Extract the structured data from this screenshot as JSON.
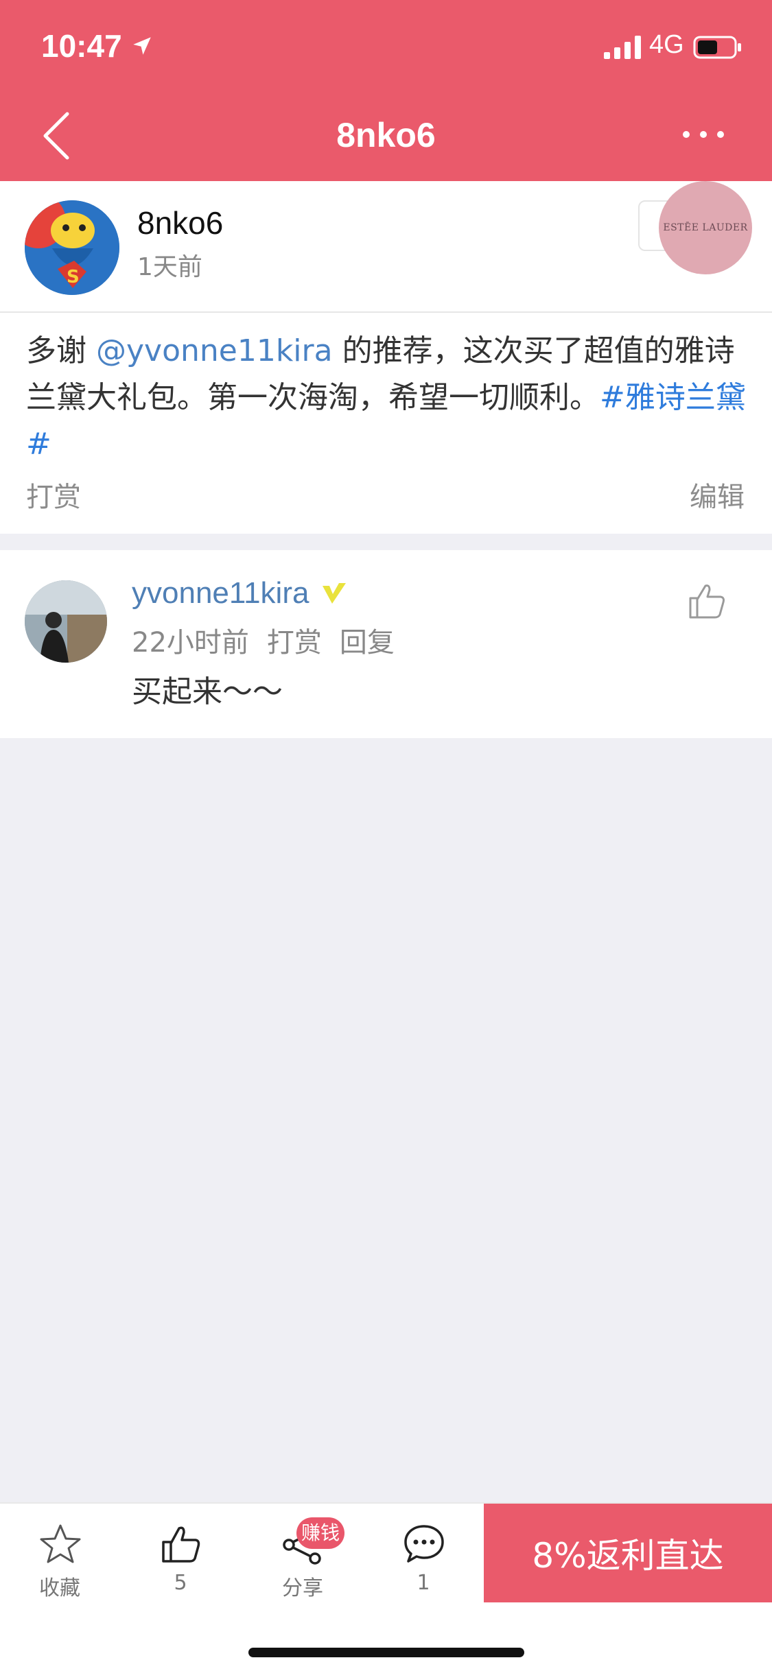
{
  "status_bar": {
    "time": "10:47",
    "network": "4G"
  },
  "nav": {
    "title": "8nko6"
  },
  "post": {
    "author_name": "8nko6",
    "time_ago": "1天前",
    "brand_label": "ESTĒE LAUDER",
    "text_prefix": "多谢 ",
    "mention": "@yvonne11kira",
    "text_body": " 的推荐，这次买了超值的雅诗兰黛大礼包。第一次海淘，希望一切顺利。",
    "hashtag": "#雅诗兰黛#",
    "reward_label": "打赏",
    "edit_label": "编辑"
  },
  "comment": {
    "user_name": "yvonne11kira",
    "time_ago": "22小时前",
    "reward_label": "打赏",
    "reply_label": "回复",
    "text": "买起来～～"
  },
  "bottom_bar": {
    "favorite_label": "收藏",
    "like_count": "5",
    "share_label": "分享",
    "earn_badge": "赚钱",
    "comment_count": "1",
    "cta_label": "8%返利直达"
  },
  "colors": {
    "accent": "#ea5a6b",
    "link": "#4a82c4",
    "hashtag": "#2f7cdc"
  }
}
